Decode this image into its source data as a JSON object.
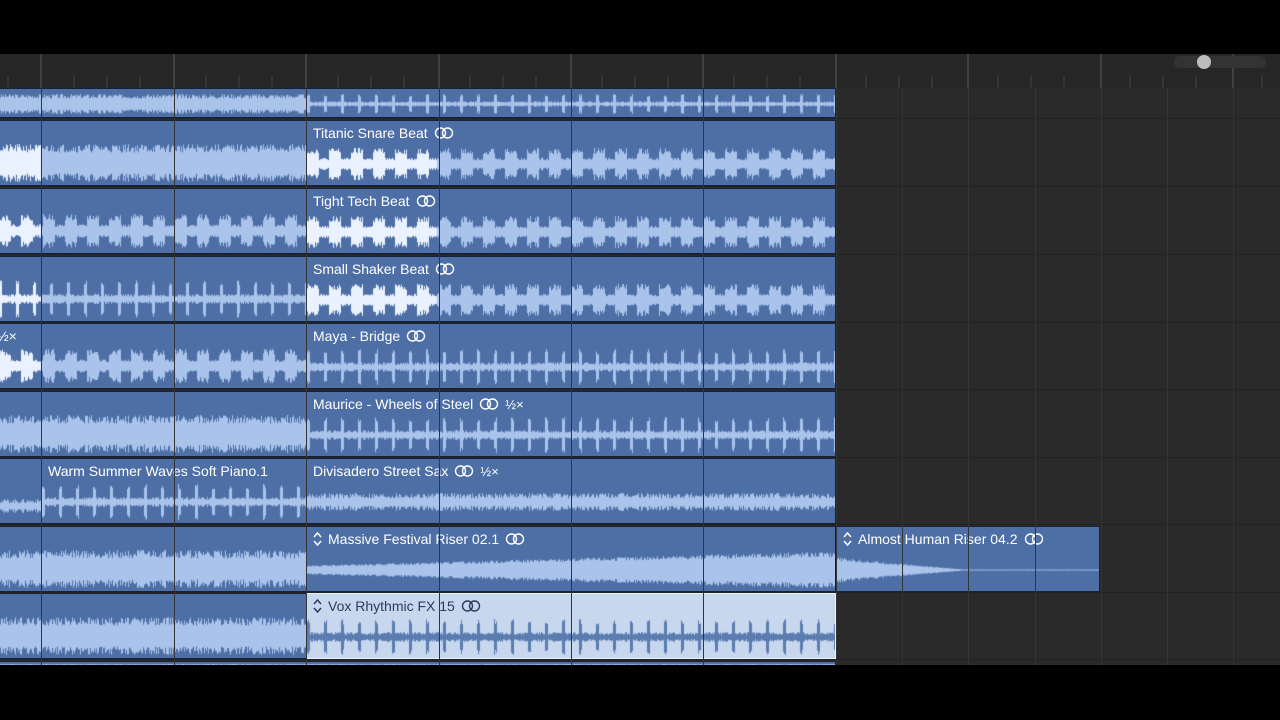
{
  "regions": [
    {
      "id": "r1a",
      "title": "Titanic Snare Beat",
      "icon": "loop-icon",
      "speed": "",
      "selected": false,
      "has_arrows": false
    },
    {
      "id": "r2a",
      "title": "Tight Tech Beat",
      "icon": "loop-icon",
      "speed": "",
      "selected": false,
      "has_arrows": false
    },
    {
      "id": "r3a",
      "title": "Small Shaker Beat",
      "icon": "loop-icon",
      "speed": "",
      "selected": false,
      "has_arrows": false
    },
    {
      "id": "r4a",
      "title": "Maya - Bridge",
      "icon": "loop-icon",
      "speed": "",
      "selected": false,
      "has_arrows": false
    },
    {
      "id": "r5a",
      "title": "Maurice - Wheels of Steel",
      "icon": "loop-icon",
      "speed": "½×",
      "selected": false,
      "has_arrows": false
    },
    {
      "id": "r6p",
      "title": "Warm Summer Waves Soft Piano.1",
      "icon": "",
      "speed": "",
      "selected": false,
      "has_arrows": false
    },
    {
      "id": "r6a",
      "title": "Divisadero Street Sax",
      "icon": "loop-icon",
      "speed": "½×",
      "selected": false,
      "has_arrows": false
    },
    {
      "id": "r7a",
      "title": "Massive Festival Riser 02.1",
      "icon": "loop-icon",
      "speed": "",
      "selected": false,
      "has_arrows": true
    },
    {
      "id": "r7b",
      "title": "Almost Human Riser 04.2",
      "icon": "loop-icon",
      "speed": "",
      "selected": false,
      "has_arrows": true
    },
    {
      "id": "r8a",
      "title": "Vox Rhythmic FX 15",
      "icon": "loop-icon",
      "speed": "",
      "selected": true,
      "has_arrows": true
    }
  ],
  "left_fragment_label": "½×",
  "colors": {
    "region": "#4d6fa6",
    "region_selected": "#c6d7ee",
    "waveform": "#a9c3ea",
    "waveform_bright": "#eaf2ff",
    "background": "#2a2a2a"
  }
}
